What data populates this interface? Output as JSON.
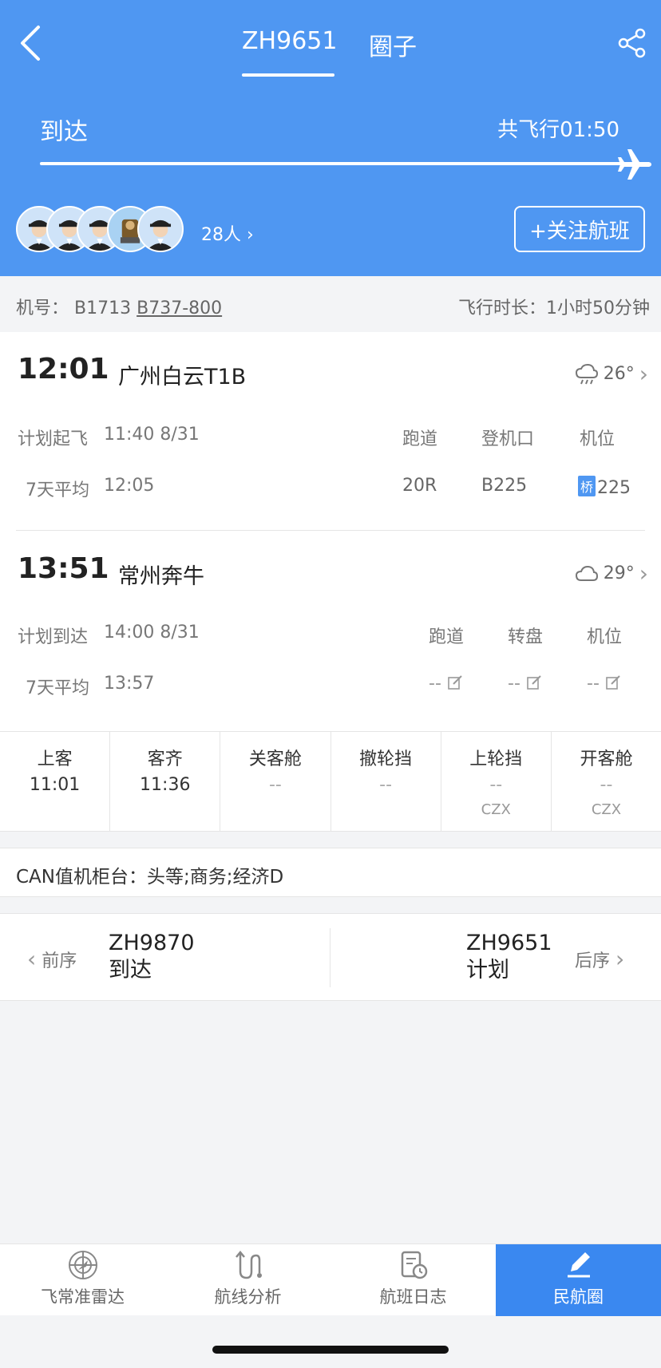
{
  "header": {
    "tab_flight": "ZH9651",
    "tab_circle": "圈子",
    "status": "到达",
    "total_flight_time": "共飞行01:50",
    "followers": "28人",
    "follow_button": "+关注航班"
  },
  "info": {
    "reg_label": "机号：",
    "reg": "B1713",
    "model": "B737-800",
    "duration_label": "飞行时长：",
    "duration": "1小时50分钟"
  },
  "departure": {
    "time": "12:01",
    "airport": "广州白云T1B",
    "temp": "26°",
    "plan_label": "计划起飞",
    "plan_time": "11:40 8/31",
    "avg_label": "7天平均",
    "avg_time": "12:05",
    "col1_h": "跑道",
    "col1_v": "20R",
    "col2_h": "登机口",
    "col2_v": "B225",
    "col3_h": "机位",
    "col3_badge": "桥",
    "col3_v": "225"
  },
  "arrival": {
    "time": "13:51",
    "airport": "常州奔牛",
    "temp": "29°",
    "plan_label": "计划到达",
    "plan_time": "14:00 8/31",
    "avg_label": "7天平均",
    "avg_time": "13:57",
    "col1_h": "跑道",
    "col1_v": "--",
    "col2_h": "转盘",
    "col2_v": "--",
    "col3_h": "机位",
    "col3_v": "--"
  },
  "milestones": [
    {
      "title": "上客",
      "value": "11:01",
      "code": ""
    },
    {
      "title": "客齐",
      "value": "11:36",
      "code": ""
    },
    {
      "title": "关客舱",
      "value": "--",
      "code": ""
    },
    {
      "title": "撤轮挡",
      "value": "--",
      "code": ""
    },
    {
      "title": "上轮挡",
      "value": "--",
      "code": "CZX"
    },
    {
      "title": "开客舱",
      "value": "--",
      "code": "CZX"
    }
  ],
  "checkin": "CAN值机柜台：头等;商务;经济D",
  "prev": {
    "label": "前序",
    "flight": "ZH9870",
    "status": "到达"
  },
  "next": {
    "label": "后序",
    "flight": "ZH9651",
    "status": "计划"
  },
  "tabbar": [
    {
      "label": "飞常准雷达",
      "icon": "radar-icon"
    },
    {
      "label": "航线分析",
      "icon": "route-icon"
    },
    {
      "label": "航班日志",
      "icon": "log-icon"
    },
    {
      "label": "民航圈",
      "icon": "pen-icon"
    }
  ],
  "colors": {
    "brand": "#4f97f2",
    "active_tab": "#3a88f0"
  }
}
